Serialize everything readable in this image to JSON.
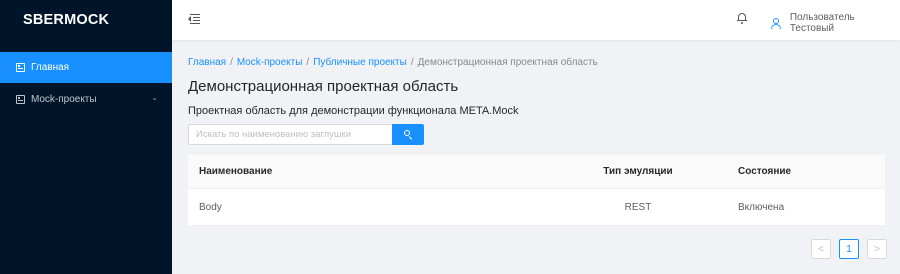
{
  "app": {
    "logo": "SBERMOCK"
  },
  "sidebar": {
    "items": [
      {
        "label": "Главная",
        "icon": "dashboard-icon",
        "active": true
      },
      {
        "label": "Mock-проекты",
        "icon": "project-icon",
        "expandable": true
      }
    ]
  },
  "header": {
    "user_name": "Пользователь Тестовый"
  },
  "breadcrumb": [
    {
      "label": "Главная",
      "link": true
    },
    {
      "label": "Mock-проекты",
      "link": true
    },
    {
      "label": "Публичные проекты",
      "link": true
    },
    {
      "label": "Демонстрационная проектная область",
      "link": false
    }
  ],
  "breadcrumb_sep": "/",
  "page": {
    "title": "Демонстрационная проектная область",
    "description": "Проектная область для демонстрации функционала META.Mock"
  },
  "search": {
    "placeholder": "Искать по наименованию заглушки"
  },
  "table": {
    "headers": [
      "Наименование",
      "Тип эмуляции",
      "Состояние"
    ],
    "rows": [
      [
        "Body",
        "REST",
        "Включена"
      ]
    ]
  },
  "pagination": {
    "current": "1",
    "prev": "<",
    "next": ">"
  },
  "colors": {
    "accent": "#1890ff",
    "sider": "#001529"
  }
}
